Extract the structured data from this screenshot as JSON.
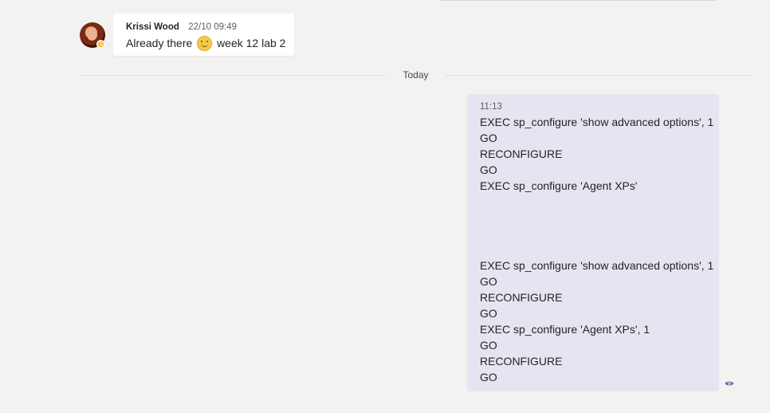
{
  "incoming_message": {
    "author": "Krissi Wood",
    "timestamp": "22/10 09:49",
    "text_before_emoji": "Already there",
    "emoji": "smile-emoji",
    "text_after_emoji": "week 12 lab 2",
    "presence_status": "away",
    "presence_color": "#fdb913"
  },
  "day_divider": {
    "label": "Today"
  },
  "outgoing_message": {
    "timestamp": "11:13",
    "lines": [
      "EXEC sp_configure 'show advanced options', 1",
      "GO",
      "RECONFIGURE",
      "GO",
      "EXEC sp_configure 'Agent XPs'",
      "",
      "",
      "",
      "",
      "EXEC sp_configure 'show advanced options', 1",
      "GO",
      "RECONFIGURE",
      "GO",
      "EXEC sp_configure 'Agent XPs', 1",
      "GO",
      "RECONFIGURE",
      "GO"
    ],
    "read_receipt_icon": "eye-icon",
    "bubble_color": "#e5e5f1"
  },
  "colors": {
    "background": "#f3f2f1",
    "accent": "#6264a7"
  }
}
